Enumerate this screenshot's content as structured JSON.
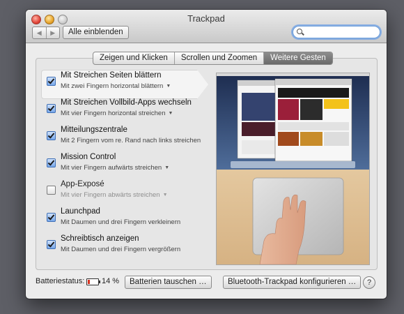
{
  "window": {
    "title": "Trackpad"
  },
  "toolbar": {
    "back_icon": "◀",
    "forward_icon": "▶",
    "show_all_label": "Alle einblenden",
    "search": {
      "value": "",
      "placeholder": ""
    }
  },
  "tabs": [
    {
      "label": "Zeigen und Klicken",
      "active": false
    },
    {
      "label": "Scrollen und Zoomen",
      "active": false
    },
    {
      "label": "Weitere Gesten",
      "active": true
    }
  ],
  "gestures": [
    {
      "title": "Mit Streichen Seiten blättern",
      "subtitle": "Mit zwei Fingern horizontal blättern",
      "has_menu": true,
      "checked": true,
      "selected": true,
      "enabled": true
    },
    {
      "title": "Mit Streichen Vollbild-Apps wechseln",
      "subtitle": "Mit vier Fingern horizontal streichen",
      "has_menu": true,
      "checked": true,
      "selected": false,
      "enabled": true
    },
    {
      "title": "Mitteilungszentrale",
      "subtitle": "Mit 2 Fingern vom re. Rand nach links streichen",
      "has_menu": false,
      "checked": true,
      "selected": false,
      "enabled": true
    },
    {
      "title": "Mission Control",
      "subtitle": "Mit vier Fingern aufwärts streichen",
      "has_menu": true,
      "checked": true,
      "selected": false,
      "enabled": true
    },
    {
      "title": "App-Exposé",
      "subtitle": "Mit vier Fingern abwärts streichen",
      "has_menu": true,
      "checked": false,
      "selected": false,
      "enabled": false
    },
    {
      "title": "Launchpad",
      "subtitle": "Mit Daumen und drei Fingern verkleinern",
      "has_menu": false,
      "checked": true,
      "selected": false,
      "enabled": true
    },
    {
      "title": "Schreibtisch anzeigen",
      "subtitle": "Mit Daumen und drei Fingern vergrößern",
      "has_menu": false,
      "checked": true,
      "selected": false,
      "enabled": true
    }
  ],
  "footer": {
    "battery_label": "Batteriestatus:",
    "battery_percent": "14 %",
    "replace_batteries_label": "Batterien tauschen …",
    "configure_bluetooth_label": "Bluetooth-Trackpad konfigurieren …",
    "help_label": "?"
  },
  "colors": {
    "accent": "#3f6fb5",
    "battery_low": "#d8321f",
    "active_tab": "#7a7a7a"
  }
}
